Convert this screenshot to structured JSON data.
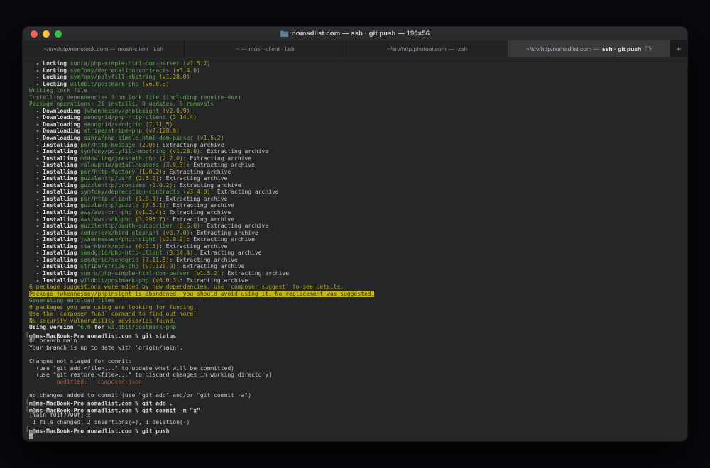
{
  "window": {
    "title": "nomadlist.com — ssh · git push — 190×56",
    "traffic_lights": [
      "close",
      "minimize",
      "zoom"
    ],
    "tabs": [
      {
        "label": "~/srv/http/remoteok.com — mosh-client · l.sh"
      },
      {
        "label": "~ — mosh-client · l.sh"
      },
      {
        "label": "~/srv/http/photoai.com — -zsh"
      },
      {
        "path": "~/srv/http/nomadlist.com — ",
        "cmd": "ssh · git push",
        "active": true,
        "activity_spinner": true
      }
    ],
    "new_tab_label": "+"
  },
  "colors": {
    "terminal_background": "#242726",
    "green": "#68a455",
    "yellow": "#b3a125",
    "highlight_background": "#c4b81c",
    "red": "#ad5a41",
    "white": "#c6c6c2",
    "bold_white": "#dcdcd8",
    "traffic_red": "#ff5f57",
    "traffic_yellow": "#febc2e",
    "traffic_green": "#28c840"
  },
  "terminal": {
    "lines": [
      [
        [
          "b",
          "  - Locking "
        ],
        [
          "g",
          "sunra/php-simple-html-dom-parser"
        ],
        [
          "y",
          " (v1.5.2)"
        ]
      ],
      [
        [
          "b",
          "  - Locking "
        ],
        [
          "g",
          "symfony/deprecation-contracts"
        ],
        [
          "y",
          " (v3.4.0)"
        ]
      ],
      [
        [
          "b",
          "  - Locking "
        ],
        [
          "g",
          "symfony/polyfill-mbstring"
        ],
        [
          "y",
          " (v1.28.0)"
        ]
      ],
      [
        [
          "b",
          "  - Locking "
        ],
        [
          "g",
          "wildbit/postmark-php"
        ],
        [
          "y",
          " (v6.0.3)"
        ]
      ],
      [
        [
          "g",
          "Writing lock file"
        ]
      ],
      [
        [
          "g",
          "Installing dependencies from lock file (including require-dev)"
        ]
      ],
      [
        [
          "g",
          "Package operations: 21 installs, 0 updates, 0 removals"
        ]
      ],
      [
        [
          "b",
          "  - Downloading "
        ],
        [
          "g",
          "jwhennessey/phpinsight"
        ],
        [
          "y",
          " (v2.0.9)"
        ]
      ],
      [
        [
          "b",
          "  - Downloading "
        ],
        [
          "g",
          "sendgrid/php-http-client"
        ],
        [
          "y",
          " (3.14.4)"
        ]
      ],
      [
        [
          "b",
          "  - Downloading "
        ],
        [
          "g",
          "sendgrid/sendgrid"
        ],
        [
          "y",
          " (7.11.5)"
        ]
      ],
      [
        [
          "b",
          "  - Downloading "
        ],
        [
          "g",
          "stripe/stripe-php"
        ],
        [
          "y",
          " (v7.128.0)"
        ]
      ],
      [
        [
          "b",
          "  - Downloading "
        ],
        [
          "g",
          "sunra/php-simple-html-dom-parser"
        ],
        [
          "y",
          " (v1.5.2)"
        ]
      ],
      [
        [
          "b",
          "  - Installing "
        ],
        [
          "g",
          "psr/http-message"
        ],
        [
          "y",
          " (2.0)"
        ],
        [
          "w",
          ": Extracting archive"
        ]
      ],
      [
        [
          "b",
          "  - Installing "
        ],
        [
          "g",
          "symfony/polyfill-mbstring"
        ],
        [
          "y",
          " (v1.28.0)"
        ],
        [
          "w",
          ": Extracting archive"
        ]
      ],
      [
        [
          "b",
          "  - Installing "
        ],
        [
          "g",
          "mtdowling/jmespath.php"
        ],
        [
          "y",
          " (2.7.0)"
        ],
        [
          "w",
          ": Extracting archive"
        ]
      ],
      [
        [
          "b",
          "  - Installing "
        ],
        [
          "g",
          "ralouphie/getallheaders"
        ],
        [
          "y",
          " (3.0.3)"
        ],
        [
          "w",
          ": Extracting archive"
        ]
      ],
      [
        [
          "b",
          "  - Installing "
        ],
        [
          "g",
          "psr/http-factory"
        ],
        [
          "y",
          " (1.0.2)"
        ],
        [
          "w",
          ": Extracting archive"
        ]
      ],
      [
        [
          "b",
          "  - Installing "
        ],
        [
          "g",
          "guzzlehttp/psr7"
        ],
        [
          "y",
          " (2.6.2)"
        ],
        [
          "w",
          ": Extracting archive"
        ]
      ],
      [
        [
          "b",
          "  - Installing "
        ],
        [
          "g",
          "guzzlehttp/promises"
        ],
        [
          "y",
          " (2.0.2)"
        ],
        [
          "w",
          ": Extracting archive"
        ]
      ],
      [
        [
          "b",
          "  - Installing "
        ],
        [
          "g",
          "symfony/deprecation-contracts"
        ],
        [
          "y",
          " (v3.4.0)"
        ],
        [
          "w",
          ": Extracting archive"
        ]
      ],
      [
        [
          "b",
          "  - Installing "
        ],
        [
          "g",
          "psr/http-client"
        ],
        [
          "y",
          " (1.0.3)"
        ],
        [
          "w",
          ": Extracting archive"
        ]
      ],
      [
        [
          "b",
          "  - Installing "
        ],
        [
          "g",
          "guzzlehttp/guzzle"
        ],
        [
          "y",
          " (7.8.1)"
        ],
        [
          "w",
          ": Extracting archive"
        ]
      ],
      [
        [
          "b",
          "  - Installing "
        ],
        [
          "g",
          "aws/aws-crt-php"
        ],
        [
          "y",
          " (v1.2.4)"
        ],
        [
          "w",
          ": Extracting archive"
        ]
      ],
      [
        [
          "b",
          "  - Installing "
        ],
        [
          "g",
          "aws/aws-sdk-php"
        ],
        [
          "y",
          " (3.295.7)"
        ],
        [
          "w",
          ": Extracting archive"
        ]
      ],
      [
        [
          "b",
          "  - Installing "
        ],
        [
          "g",
          "guzzlehttp/oauth-subscriber"
        ],
        [
          "y",
          " (0.6.0)"
        ],
        [
          "w",
          ": Extracting archive"
        ]
      ],
      [
        [
          "b",
          "  - Installing "
        ],
        [
          "g",
          "coderjerk/bird-elephant"
        ],
        [
          "y",
          " (v0.7.0)"
        ],
        [
          "w",
          ": Extracting archive"
        ]
      ],
      [
        [
          "b",
          "  - Installing "
        ],
        [
          "g",
          "jwhennessey/phpinsight"
        ],
        [
          "y",
          " (v2.0.9)"
        ],
        [
          "w",
          ": Extracting archive"
        ]
      ],
      [
        [
          "b",
          "  - Installing "
        ],
        [
          "g",
          "starkbank/ecdsa"
        ],
        [
          "y",
          " (0.0.5)"
        ],
        [
          "w",
          ": Extracting archive"
        ]
      ],
      [
        [
          "b",
          "  - Installing "
        ],
        [
          "g",
          "sendgrid/php-http-client"
        ],
        [
          "y",
          " (3.14.4)"
        ],
        [
          "w",
          ": Extracting archive"
        ]
      ],
      [
        [
          "b",
          "  - Installing "
        ],
        [
          "g",
          "sendgrid/sendgrid"
        ],
        [
          "y",
          " (7.11.5)"
        ],
        [
          "w",
          ": Extracting archive"
        ]
      ],
      [
        [
          "b",
          "  - Installing "
        ],
        [
          "g",
          "stripe/stripe-php"
        ],
        [
          "y",
          " (v7.128.0)"
        ],
        [
          "w",
          ": Extracting archive"
        ]
      ],
      [
        [
          "b",
          "  - Installing "
        ],
        [
          "g",
          "sunra/php-simple-html-dom-parser"
        ],
        [
          "y",
          " (v1.5.2)"
        ],
        [
          "w",
          ": Extracting archive"
        ]
      ],
      [
        [
          "b",
          "  - Installing "
        ],
        [
          "g",
          "wildbit/postmark-php"
        ],
        [
          "y",
          " (v6.0.3)"
        ],
        [
          "w",
          ": Extracting archive"
        ]
      ],
      [
        [
          "y",
          "6 package suggestions were added by new dependencies, use `composer suggest` to see details."
        ]
      ],
      [
        [
          "hl",
          "Package jwhennessey/phpinsight is abandoned, you should avoid using it. No replacement was suggested."
        ]
      ],
      [
        [
          "g",
          "Generating autoload files"
        ]
      ],
      [
        [
          "y",
          "6 packages you are using are looking for funding."
        ]
      ],
      [
        [
          "y",
          "Use the `composer fund` command to find out more!"
        ]
      ],
      [
        [
          "y",
          "No security vulnerability advisories found."
        ]
      ],
      [
        [
          "b",
          "Using version "
        ],
        [
          "g",
          "^6.0"
        ],
        [
          "b",
          " for "
        ],
        [
          "g",
          "wildbit/postmark-php"
        ]
      ],
      [
        [
          "mk",
          "["
        ],
        [
          "b",
          "m@ms-MacBook-Pro nomadlist.com % git status"
        ]
      ],
      [
        [
          "w",
          "On branch main"
        ]
      ],
      [
        [
          "w",
          "Your branch is up to date with 'origin/main'."
        ]
      ],
      [],
      [
        [
          "w",
          "Changes not staged for commit:"
        ]
      ],
      [
        [
          "w",
          "  (use \"git add <file>...\" to update what will be committed)"
        ]
      ],
      [
        [
          "w",
          "  (use \"git restore <file>...\" to discard changes in working directory)"
        ]
      ],
      [
        [
          "r",
          "        modified:   composer.json"
        ]
      ],
      [],
      [
        [
          "w",
          "no changes added to commit (use \"git add\" and/or \"git commit -a\")"
        ]
      ],
      [
        [
          "mk",
          "["
        ],
        [
          "b",
          "m@ms-MacBook-Pro nomadlist.com % git add ."
        ]
      ],
      [
        [
          "mk",
          "["
        ],
        [
          "b",
          "m@ms-MacBook-Pro nomadlist.com % git commit -m \"x\""
        ]
      ],
      [
        [
          "w",
          "[main f01f7799f] x"
        ]
      ],
      [
        [
          "w",
          " 1 file changed, 2 insertions(+), 1 deletion(-)"
        ]
      ],
      [
        [
          "mk",
          "["
        ],
        [
          "b",
          "m@ms-MacBook-Pro nomadlist.com % git push"
        ]
      ],
      [
        [
          "cur",
          ""
        ]
      ]
    ]
  }
}
